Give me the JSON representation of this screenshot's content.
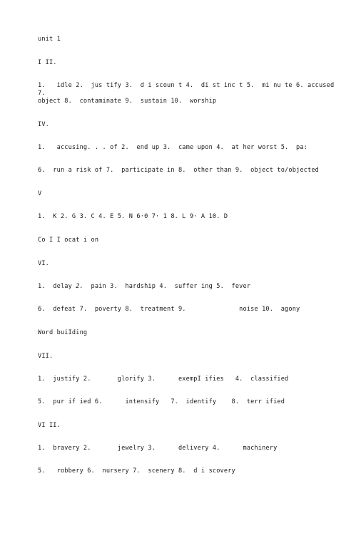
{
  "document": {
    "title": "unit 1",
    "blocks": [
      {
        "id": "title",
        "text": "unit 1"
      },
      {
        "id": "heading-3",
        "text": "I II."
      },
      {
        "id": "section-3-line-1",
        "text": "1.   idle 2.  jus tify 3.  d i scoun t 4.  di st inc t 5.  mi nu te 6. accused 7."
      },
      {
        "id": "section-3-line-2",
        "text": "object 8.  contaminate 9.  sustain 10.  worship"
      },
      {
        "id": "heading-4",
        "text": "IV."
      },
      {
        "id": "section-4-line-1",
        "text": "1.   accusing. . . of 2.  end up 3.  came upon 4.  at her worst 5.  pa:"
      },
      {
        "id": "section-4-line-2",
        "text": "6.  run a risk of 7.  participate in 8.  other than 9.  object to/objected"
      },
      {
        "id": "heading-5",
        "text": "V"
      },
      {
        "id": "section-5-line-1",
        "text": "1.  K 2. G 3. C 4. E 5. N 6·0 7· 1 8. L 9· A 10. D"
      },
      {
        "id": "heading-collocation",
        "text": "Co I I ocat i on"
      },
      {
        "id": "heading-6",
        "text": "VI."
      },
      {
        "id": "section-6-line-1-a",
        "text": "1.  delay "
      },
      {
        "id": "section-6-line-1-italic",
        "text": "2."
      },
      {
        "id": "section-6-line-1-b",
        "text": "  pain 3.  hardship 4.  suffer ing 5.  fever"
      },
      {
        "id": "section-6-line-2",
        "text": "6.  defeat 7.  poverty 8.  treatment 9.              noise 10.  agony"
      },
      {
        "id": "heading-word-building",
        "text": "Word buiIding"
      },
      {
        "id": "heading-7",
        "text": "VII."
      },
      {
        "id": "section-7-line-1",
        "text": "1.  justify 2.       glorify 3.      exempI ifies   4.  classified"
      },
      {
        "id": "section-7-line-2",
        "text": "5.  pur if ied 6.      intensify   7.  identify    8.  terr ified"
      },
      {
        "id": "heading-8",
        "text": "VI II."
      },
      {
        "id": "section-8-line-1",
        "text": "1.  bravery 2.       jewelry 3.      delivery 4.      machinery"
      },
      {
        "id": "section-8-line-2",
        "text": "5.   robbery 6.  nursery 7.  scenery 8.  d i scovery"
      }
    ]
  },
  "style": {
    "text_color": "#1a1a1a",
    "background_color": "#ffffff"
  }
}
